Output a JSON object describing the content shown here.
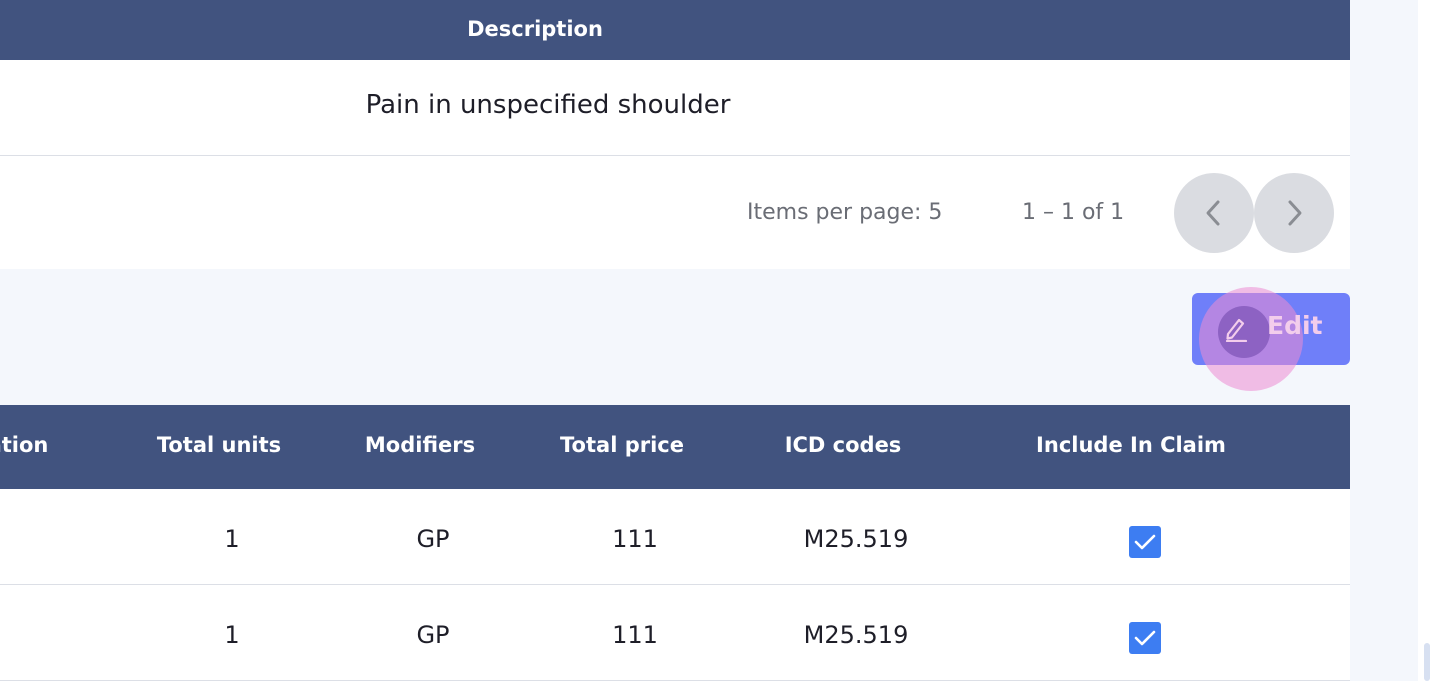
{
  "description_table": {
    "header": "Description",
    "rows": [
      {
        "description": "Pain in unspecified shoulder"
      }
    ]
  },
  "paginator": {
    "items_per_page_label": "Items per page: 5",
    "range_label": "1 – 1 of 1",
    "prev_icon": "chevron-left-icon",
    "next_icon": "chevron-right-icon"
  },
  "edit_button": {
    "label": "Edit",
    "icon": "pencil-icon"
  },
  "claim_table": {
    "columns": [
      "ation",
      "Total units",
      "Modifiers",
      "Total price",
      "ICD codes",
      "Include In Claim"
    ],
    "rows": [
      {
        "total_units": "1",
        "modifiers": "GP",
        "total_price": "111",
        "icd_codes": "M25.519",
        "include_in_claim": true
      },
      {
        "total_units": "1",
        "modifiers": "GP",
        "total_price": "111",
        "icd_codes": "M25.519",
        "include_in_claim": true
      }
    ]
  },
  "colors": {
    "header_bg": "#41537f",
    "edit_button_bg": "#6f7ff9",
    "checkbox_bg": "#3d7df2",
    "page_bg": "#f4f7fc"
  }
}
